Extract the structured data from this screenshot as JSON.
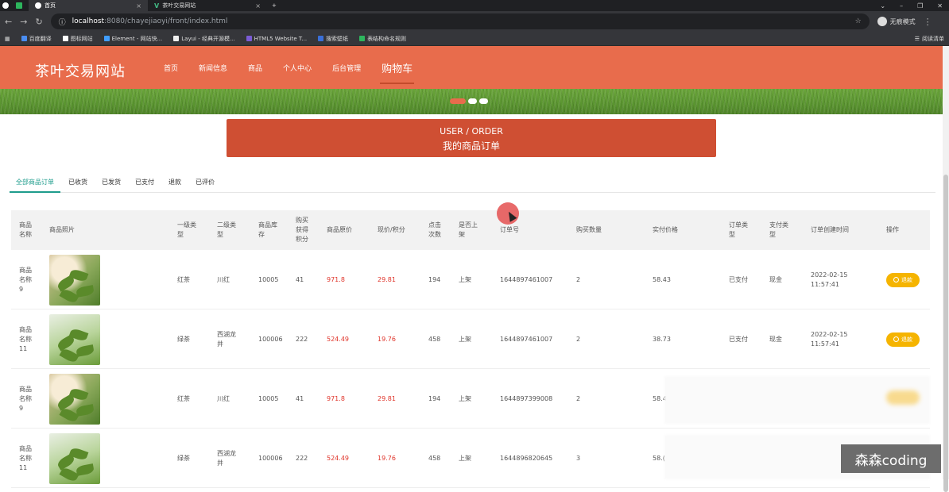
{
  "browser": {
    "tabs": [
      {
        "label": ""
      },
      {
        "label": ""
      },
      {
        "label": "首页"
      },
      {
        "label": "茶叶交易网站"
      }
    ],
    "new_tab": "+",
    "url_host": "localhost",
    "url_path": ":8080/chayejiaoyi/front/index.html",
    "incognito_label": "无痕模式",
    "bookmarks": [
      "百度翻译",
      "图标网站",
      "Element - 网站快...",
      "Layui - 经典开源模...",
      "HTML5 Website T...",
      "搜索壁纸",
      "表结构命名规则"
    ],
    "reading_list": "阅读清单"
  },
  "site": {
    "title": "茶叶交易网站",
    "nav": [
      "首页",
      "新闻信息",
      "商品",
      "个人中心",
      "后台管理",
      "购物车"
    ],
    "active_nav": "购物车"
  },
  "section": {
    "title_en": "USER / ORDER",
    "title_cn": "我的商品订单"
  },
  "order_tabs": [
    "全部商品订单",
    "已收货",
    "已发货",
    "已支付",
    "退款",
    "已评价"
  ],
  "table": {
    "headers": [
      "商品\n名称",
      "商品照片",
      "一级类\n型",
      "二级类\n型",
      "商品库\n存",
      "购买\n获得\n积分",
      "商品原价",
      "现价/积分",
      "点击\n次数",
      "是否上\n架",
      "订单号",
      "购买数量",
      "实付价格",
      "订单类\n型",
      "支付类\n型",
      "订单创建时间",
      "操作"
    ],
    "rows": [
      {
        "name": "商品\n名称\n9",
        "type1": "红茶",
        "type2": "川红",
        "stock": "10005",
        "points": "41",
        "orig": "971.8",
        "now": "29.81",
        "clicks": "194",
        "shelf": "上架",
        "order_no": "1644897461007",
        "qty": "2",
        "paid": "58.43",
        "order_type": "已支付",
        "pay_type": "现金",
        "created": "2022-02-15\n11:57:41",
        "action": "退款"
      },
      {
        "name": "商品\n名称\n11",
        "type1": "绿茶",
        "type2": "西湖龙\n井",
        "stock": "100006",
        "points": "222",
        "orig": "524.49",
        "now": "19.76",
        "clicks": "458",
        "shelf": "上架",
        "order_no": "1644897461007",
        "qty": "2",
        "paid": "38.73",
        "order_type": "已支付",
        "pay_type": "现金",
        "created": "2022-02-15\n11:57:41",
        "action": "退款"
      },
      {
        "name": "商品\n名称\n9",
        "type1": "红茶",
        "type2": "川红",
        "stock": "10005",
        "points": "41",
        "orig": "971.8",
        "now": "29.81",
        "clicks": "194",
        "shelf": "上架",
        "order_no": "1644897399008",
        "qty": "2",
        "paid": "58.4",
        "order_type": "",
        "pay_type": "",
        "created": "",
        "action": ""
      },
      {
        "name": "商品\n名称\n11",
        "type1": "绿茶",
        "type2": "西湖龙\n井",
        "stock": "100006",
        "points": "222",
        "orig": "524.49",
        "now": "19.76",
        "clicks": "458",
        "shelf": "上架",
        "order_no": "1644896820645",
        "qty": "3",
        "paid": "58.(",
        "order_type": "",
        "pay_type": "",
        "created": "",
        "action": ""
      }
    ]
  },
  "watermark": "森森coding",
  "colors": {
    "header": "#e86c4c",
    "section": "#cf4f33",
    "accent_tab": "#1e9c8c",
    "price_red": "#e0352b",
    "refund": "#f5b400"
  }
}
